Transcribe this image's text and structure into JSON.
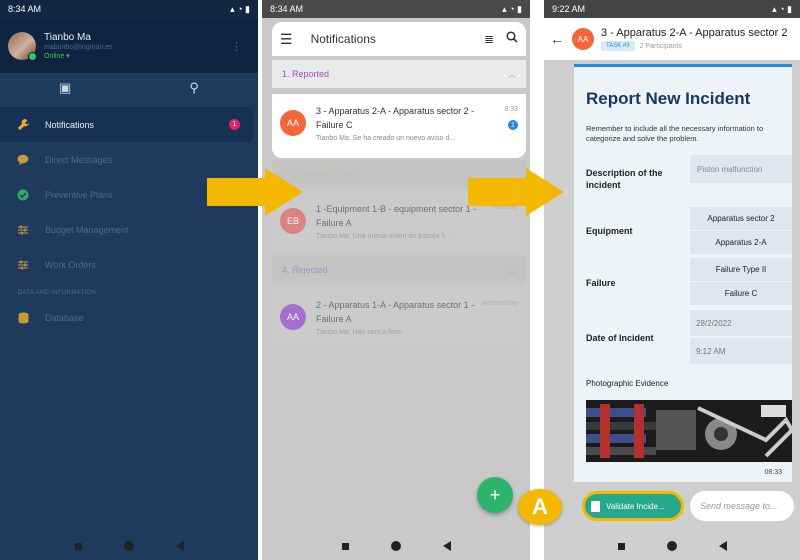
{
  "panel_left": {
    "status_time": "8:34 AM",
    "user": {
      "name": "Tianbo Ma",
      "email": "mabunbo@ingman.es",
      "status": "Online"
    },
    "menu": [
      {
        "label": "Notifications",
        "icon": "wrench-icon",
        "badge": "1",
        "active": true
      },
      {
        "label": "Direct Messages",
        "icon": "chat-bubble-icon",
        "active": false
      },
      {
        "label": "Preventive Plans",
        "icon": "check-circle-icon",
        "active": false
      },
      {
        "label": "Budget Management",
        "icon": "sliders-icon",
        "active": false
      },
      {
        "label": "Work Orders",
        "icon": "sliders-icon",
        "active": false
      }
    ],
    "section_label": "DATA AND INFORMATION",
    "database_label": "Database"
  },
  "panel_middle": {
    "status_time": "8:34 AM",
    "title": "Notifications",
    "sections": {
      "reported": "1. Reported",
      "completed": "3. Completed tasks",
      "rejected": "4. Rejected"
    },
    "cards": [
      {
        "initials": "AA",
        "title": "3 - Apparatus 2-A - Apparatus sector 2 - Failure C",
        "preview": "Tianbo Ma: Se ha creado un nuevo aviso d...",
        "time": "8:33",
        "unread": "1",
        "avatar_color": "#f2663a"
      },
      {
        "initials": "EB",
        "title": "1 -Equipment 1-B - equipment sector 1 - Failure A",
        "preview": "Tianbo Ma: Una nueva orden de trabajo h...",
        "time": "monday",
        "avatar_color": "#e85c5c"
      },
      {
        "initials": "AA",
        "title": "2 - Apparatus 1-A - Apparatus sector 1 - Failure A",
        "preview": "Tianbo Ma: Has sent a form",
        "time": "wednesday",
        "avatar_color": "#9b59d0"
      }
    ],
    "fab": "+"
  },
  "panel_right": {
    "status_time": "9:22 AM",
    "chat_title": "3 - Apparatus 2-A - Apparatus sector 2",
    "avatar_initials": "AA",
    "tag": "TASK #3",
    "participants": "2 Participants",
    "form": {
      "title": "Report New Incident",
      "description": "Remember to include all the necessary information to categorize and solve the problem.",
      "desc_label": "Description of the incident",
      "desc_value": "Piston malfunction",
      "equipment_label": "Equipment",
      "equipment_values": [
        "Apparatus sector 2",
        "Apparatus 2-A"
      ],
      "failure_label": "Failure",
      "failure_values": [
        "Failure Type II",
        "Failure C"
      ],
      "date_label": "Date of Incident",
      "date_value": "28/2/2022",
      "time_value": "9:12 AM",
      "photo_label": "Photographic Evidence",
      "timestamp": "08:33"
    },
    "validate_label": "Validate Incide...",
    "message_placeholder": "Send message to..."
  },
  "callout_label": "A",
  "colors": {
    "accent_yellow": "#f5b800",
    "sidebar": "#1e3b5d",
    "brand_blue": "#1e88e5",
    "validate_green": "#26a88a"
  }
}
